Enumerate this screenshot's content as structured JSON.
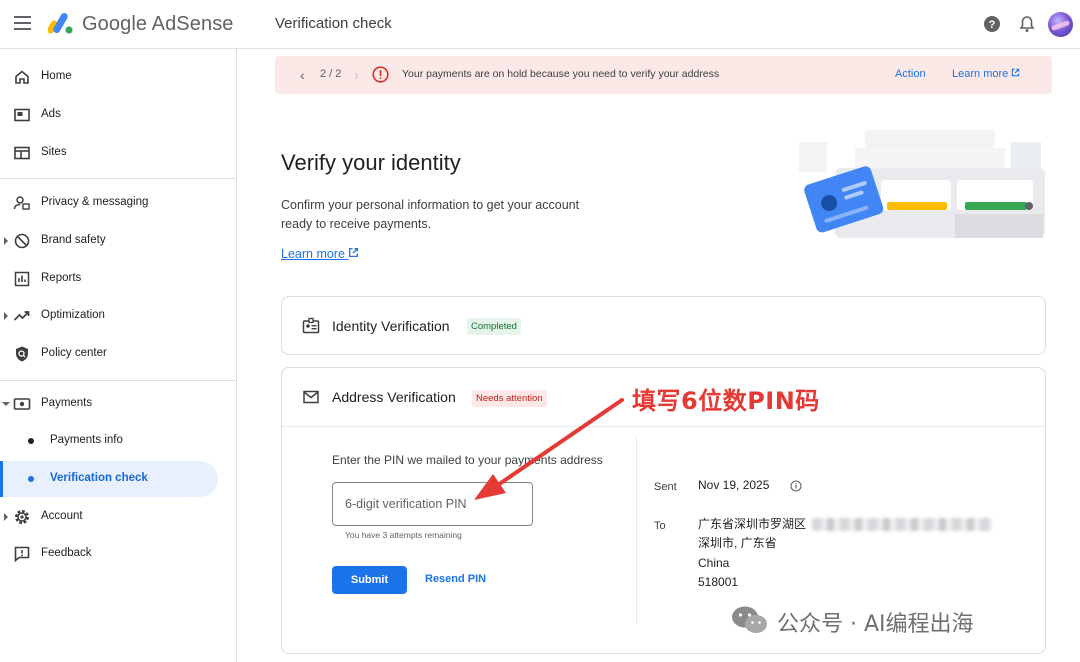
{
  "app": {
    "brand": "Google AdSense",
    "page_title": "Verification check"
  },
  "colors": {
    "accent": "#1a73e8",
    "alert": "#d93025",
    "banner_bg": "#fce8e6",
    "completed": "#137333",
    "annotation": "#e53935"
  },
  "sidebar": {
    "items": [
      {
        "label": "Home",
        "icon": "home-icon"
      },
      {
        "label": "Ads",
        "icon": "ads-icon"
      },
      {
        "label": "Sites",
        "icon": "sites-icon"
      },
      {
        "label": "Privacy & messaging",
        "icon": "privacy-icon"
      },
      {
        "label": "Brand safety",
        "icon": "block-icon"
      },
      {
        "label": "Reports",
        "icon": "reports-icon"
      },
      {
        "label": "Optimization",
        "icon": "trending-icon"
      },
      {
        "label": "Policy center",
        "icon": "policy-icon"
      },
      {
        "label": "Payments",
        "icon": "payments-icon"
      },
      {
        "label": "Payments info"
      },
      {
        "label": "Verification check"
      },
      {
        "label": "Account",
        "icon": "gear-icon"
      },
      {
        "label": "Feedback",
        "icon": "feedback-icon"
      }
    ]
  },
  "banner": {
    "counter": "2 / 2",
    "message": "Your payments are on hold because you need to verify your address",
    "action": "Action",
    "learn_more": "Learn more"
  },
  "main": {
    "title": "Verify your identity",
    "description": "Confirm your personal information to get your account ready to receive payments.",
    "learn_more": "Learn more"
  },
  "identity_card": {
    "title": "Identity Verification",
    "status": "Completed"
  },
  "address_card": {
    "title": "Address Verification",
    "status": "Needs attention",
    "pin_prompt": "Enter the PIN we mailed to your payments address",
    "pin_placeholder": "6-digit verification PIN",
    "attempts": "You have 3 attempts remaining",
    "submit": "Submit",
    "resend": "Resend PIN",
    "sent_label": "Sent",
    "sent_date": "Nov 19, 2025",
    "to_label": "To",
    "address_line1": "广东省深圳市罗湖区",
    "address_line2": "深圳市, 广东省",
    "address_line3": "China",
    "address_line4": "518001"
  },
  "annotation": {
    "text": "填写6位数PIN码"
  },
  "watermark": {
    "text": "公众号 · AI编程出海"
  }
}
